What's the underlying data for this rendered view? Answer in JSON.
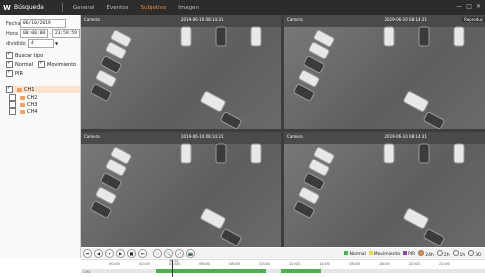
{
  "app": {
    "logo": "W",
    "title": "Búsqueda"
  },
  "tabs": [
    {
      "label": "General",
      "active": false
    },
    {
      "label": "Eventos",
      "active": false
    },
    {
      "label": "Subjetivo",
      "active": true
    },
    {
      "label": "Imagen",
      "active": false
    }
  ],
  "window_controls": [
    "—",
    "□",
    "✕"
  ],
  "search": {
    "date_label": "Fecha",
    "date_value": "06/10/2019",
    "time_label": "Hora",
    "time_start": "00:00:00",
    "time_end": "23:59:59",
    "divide_label": "dividido",
    "divide_value": "4",
    "search_types_label": "Buscar tipo",
    "types": [
      {
        "label": "Normal",
        "checked": true
      },
      {
        "label": "Movimiento",
        "checked": true
      },
      {
        "label": "PIR",
        "checked": true
      }
    ],
    "channels": [
      {
        "label": "CH1",
        "checked": true,
        "selected": true
      },
      {
        "label": "CH2",
        "checked": false,
        "selected": false
      },
      {
        "label": "CH3",
        "checked": false,
        "selected": false
      },
      {
        "label": "CH4",
        "checked": false,
        "selected": false
      }
    ]
  },
  "video": {
    "quads": [
      {
        "label": "Camera",
        "timestamp": "2019-06-10 08:14:31",
        "tag": ""
      },
      {
        "label": "Camera",
        "timestamp": "2019-06-10 08:14:31",
        "tag": "Reproduc"
      },
      {
        "label": "Camera",
        "timestamp": "2019-06-10 08:14:31",
        "tag": ""
      },
      {
        "label": "Camera",
        "timestamp": "2019-06-10 08:14:31",
        "tag": ""
      }
    ]
  },
  "playback": {
    "buttons": [
      "⏮",
      "◀",
      "⏸",
      "▶",
      "■",
      "⏭",
      "⛶",
      "🔍",
      "⤢",
      "📷"
    ],
    "legend": [
      {
        "label": "Normal",
        "color": "#4caf50"
      },
      {
        "label": "Movimiento",
        "color": "#e8d44d"
      },
      {
        "label": "PIR",
        "color": "#8e44ad"
      }
    ],
    "ranges": [
      "24h",
      "2h",
      "1h",
      "30"
    ],
    "selected_range": "24h"
  },
  "timeline": {
    "ticks": [
      "00:00",
      "02:00",
      "04:00",
      "06:00",
      "08:00",
      "10:00",
      "12:00",
      "14:00",
      "16:00",
      "18:00",
      "20:00",
      "22:00"
    ],
    "cursor_time": "08:14",
    "channel_label": "CH1"
  }
}
